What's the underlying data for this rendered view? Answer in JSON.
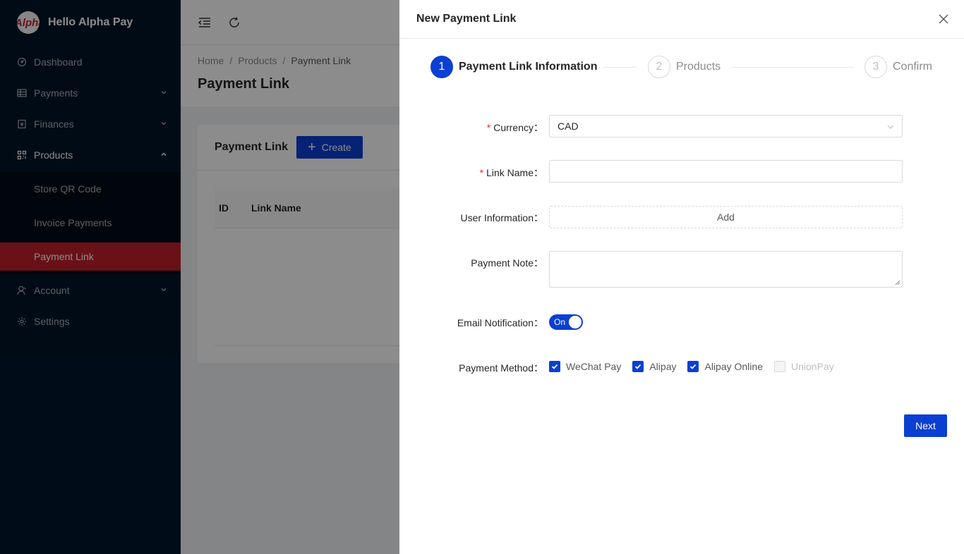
{
  "app": {
    "logo_text": "Alpha",
    "title": "Hello Alpha Pay"
  },
  "sidebar": {
    "items": [
      {
        "label": "Dashboard",
        "icon": "dashboard-icon"
      },
      {
        "label": "Payments",
        "icon": "table-icon"
      },
      {
        "label": "Finances",
        "icon": "ledger-icon"
      },
      {
        "label": "Products",
        "icon": "qrcode-icon"
      },
      {
        "label": "Account",
        "icon": "user-icon"
      },
      {
        "label": "Settings",
        "icon": "gear-icon"
      }
    ],
    "products_sub": [
      {
        "label": "Store QR Code"
      },
      {
        "label": "Invoice Payments"
      },
      {
        "label": "Payment Link"
      }
    ]
  },
  "breadcrumb": [
    "Home",
    "Products",
    "Payment Link"
  ],
  "page": {
    "title": "Payment Link",
    "card_title": "Payment Link",
    "create_label": "Create",
    "columns": [
      "ID",
      "Link Name"
    ]
  },
  "drawer": {
    "title": "New Payment Link",
    "steps": [
      {
        "num": "1",
        "label": "Payment Link Information"
      },
      {
        "num": "2",
        "label": "Products"
      },
      {
        "num": "3",
        "label": "Confirm"
      }
    ],
    "form": {
      "currency_label": "Currency",
      "currency_value": "CAD",
      "link_name_label": "Link Name",
      "link_name_value": "",
      "user_info_label": "User Information",
      "user_info_add": "Add",
      "payment_note_label": "Payment Note",
      "payment_note_value": "",
      "email_label": "Email Notification",
      "email_switch": "On",
      "payment_method_label": "Payment Method",
      "methods": [
        {
          "label": "WeChat Pay",
          "checked": true,
          "disabled": false
        },
        {
          "label": "Alipay",
          "checked": true,
          "disabled": false
        },
        {
          "label": "Alipay Online",
          "checked": true,
          "disabled": false
        },
        {
          "label": "UnionPay",
          "checked": false,
          "disabled": true
        }
      ],
      "colon": "："
    },
    "next_label": "Next"
  },
  "colors": {
    "sidebar_bg": "#001529",
    "active_item": "#c0202a",
    "primary": "#0b3fd4"
  }
}
